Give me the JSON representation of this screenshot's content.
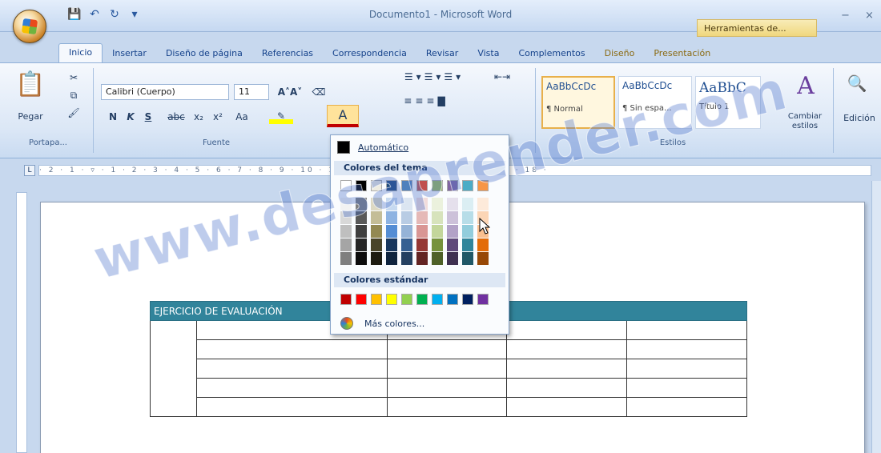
{
  "window": {
    "title": "Documento1 - Microsoft Word",
    "contextual_tab_group": "Herramientas de...",
    "minimize": "−",
    "close": "×"
  },
  "quick_access": [
    "save-icon",
    "undo-icon",
    "redo-icon",
    "customize-icon"
  ],
  "tabs": [
    {
      "label": "Inicio",
      "active": true
    },
    {
      "label": "Insertar"
    },
    {
      "label": "Diseño de página"
    },
    {
      "label": "Referencias"
    },
    {
      "label": "Correspondencia"
    },
    {
      "label": "Revisar"
    },
    {
      "label": "Vista"
    },
    {
      "label": "Complementos"
    },
    {
      "label": "Diseño"
    },
    {
      "label": "Presentación"
    }
  ],
  "ribbon": {
    "clipboard": {
      "paste_label": "Pegar",
      "group_label": "Portapa..."
    },
    "font": {
      "font_name": "Calibri (Cuerpo)",
      "font_size": "11",
      "group_label": "Fuente",
      "bold": "N",
      "italic": "K",
      "underline": "S",
      "strike": "abc",
      "subscript": "x₂",
      "superscript": "x²",
      "case": "Aa",
      "font_color": "A"
    },
    "styles": {
      "group_label": "Estilos",
      "items": [
        {
          "sample": "AaBbCcDc",
          "name": "¶ Normal"
        },
        {
          "sample": "AaBbCcDc",
          "name": "¶ Sin espa..."
        },
        {
          "sample": "AaBbC",
          "name": "Título 1"
        }
      ],
      "change_styles": "Cambiar estilos"
    },
    "editing_label": "Edición"
  },
  "color_menu": {
    "automatic_label": "Automático",
    "theme_colors_label": "Colores del tema",
    "standard_colors_label": "Colores estándar",
    "more_colors_label": "Más colores...",
    "theme_top_row": [
      "#ffffff",
      "#000000",
      "#eeece1",
      "#1f497d",
      "#4f81bd",
      "#c0504d",
      "#9bbb59",
      "#8064a2",
      "#4bacc6",
      "#f79646"
    ],
    "theme_shade_columns": [
      [
        "#f2f2f2",
        "#d8d8d8",
        "#bfbfbf",
        "#a5a5a5",
        "#7f7f7f"
      ],
      [
        "#7f7f7f",
        "#595959",
        "#3f3f3f",
        "#262626",
        "#0c0c0c"
      ],
      [
        "#ddd9c3",
        "#c4bd97",
        "#938953",
        "#494429",
        "#1d1b10"
      ],
      [
        "#c6d9f0",
        "#8db3e2",
        "#548dd4",
        "#17365d",
        "#0f243e"
      ],
      [
        "#dbe5f1",
        "#b8cce4",
        "#95b3d7",
        "#366092",
        "#244061"
      ],
      [
        "#f2dcdb",
        "#e5b9b7",
        "#d99694",
        "#953734",
        "#632423"
      ],
      [
        "#ebf1dd",
        "#d7e3bc",
        "#c3d69b",
        "#76923c",
        "#4f6128"
      ],
      [
        "#e5e0ec",
        "#ccc1d9",
        "#b2a2c7",
        "#5f497a",
        "#3f3151"
      ],
      [
        "#dbeef3",
        "#b7dde8",
        "#92cddc",
        "#31859b",
        "#205867"
      ],
      [
        "#fdeada",
        "#fbd5b5",
        "#fac08f",
        "#e36c09",
        "#974806"
      ]
    ],
    "standard_row": [
      "#c00000",
      "#ff0000",
      "#ffc000",
      "#ffff00",
      "#92d050",
      "#00b050",
      "#00b0f0",
      "#0070c0",
      "#002060",
      "#7030a0"
    ]
  },
  "document": {
    "table_header": "EJERCICIO DE EVALUACIÓN"
  },
  "watermark": "www.desaprender.com"
}
